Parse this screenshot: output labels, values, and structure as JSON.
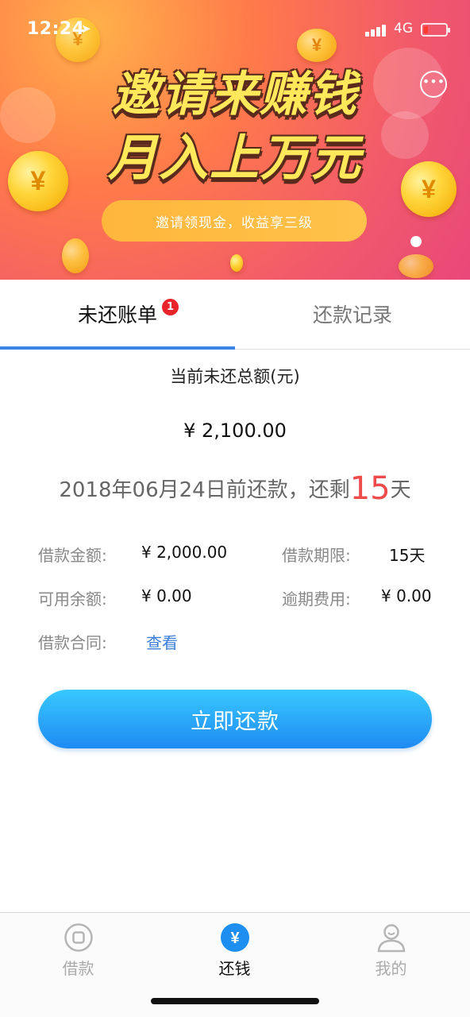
{
  "status_bar": {
    "time": "12:24",
    "network": "4G",
    "location_icon": "location-arrow-icon",
    "battery_color": "#ff3b30"
  },
  "banner": {
    "headline_line1": "邀请来赚钱",
    "headline_line2": "月入上万元",
    "pill_text": "邀请领现金，收益享三级",
    "message_icon": "chat-bubble-icon",
    "coin_symbol": "¥",
    "page_indicator": {
      "current": 1
    }
  },
  "tabs": [
    {
      "label": "未还账单",
      "badge": "1",
      "active": true
    },
    {
      "label": "还款记录",
      "active": false
    }
  ],
  "summary": {
    "total_label": "当前未还总额(元)",
    "total_amount": "¥ 2,100.00",
    "due_prefix": "2018年06月24日前还款，还剩",
    "due_days": "15",
    "due_suffix": "天"
  },
  "details": {
    "loan_amount_label": "借款金额:",
    "loan_amount_value": "¥ 2,000.00",
    "loan_term_label": "借款期限:",
    "loan_term_value": "15天",
    "available_label": "可用余额:",
    "available_value": "¥ 0.00",
    "overdue_label": "逾期费用:",
    "overdue_value": "¥ 0.00",
    "contract_label": "借款合同:",
    "contract_link": "查看"
  },
  "actions": {
    "repay_button": "立即还款"
  },
  "bottom_nav": [
    {
      "label": "借款",
      "icon": "borrow-icon",
      "active": false
    },
    {
      "label": "还钱",
      "icon": "yen-coin-icon",
      "active": true,
      "icon_symbol": "¥"
    },
    {
      "label": "我的",
      "icon": "user-icon",
      "active": false
    }
  ],
  "colors": {
    "accent_blue": "#3b86e8",
    "highlight_red": "#ee4b4b",
    "badge_red": "#e8232a",
    "button_gradient_top": "#38c8ff",
    "button_gradient_bottom": "#1f8bf2"
  }
}
